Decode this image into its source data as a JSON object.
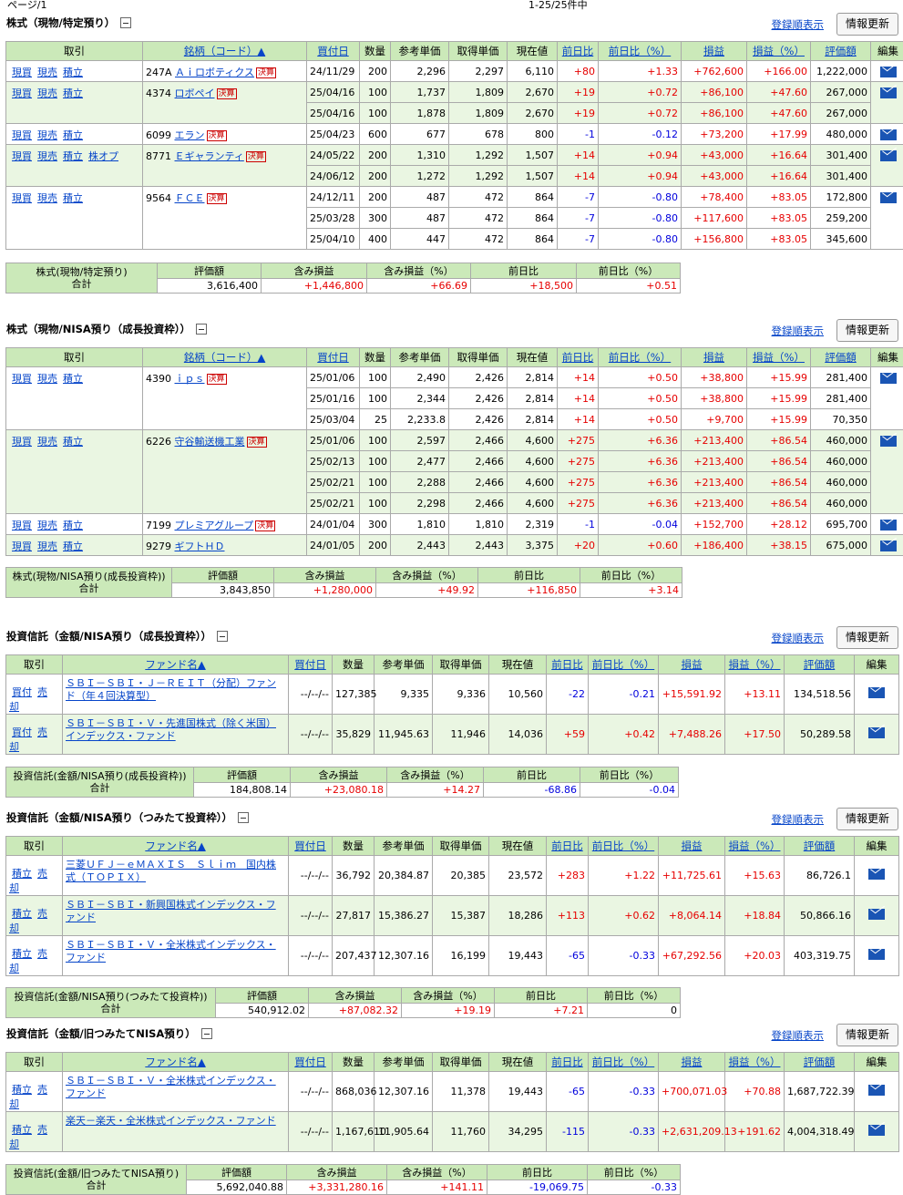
{
  "header": {
    "page": "ページ/1",
    "range": "1-25/25件中"
  },
  "common": {
    "link": "登録順表示",
    "button": "情報更新"
  },
  "sections": [
    {
      "title": "株式（現物/特定預り）",
      "type": "stock",
      "cols": [
        "取引",
        "銘柄（コード）▲",
        "買付日",
        "数量",
        "参考単価",
        "取得単価",
        "現在値",
        "前日比",
        "前日比（%）",
        "損益",
        "損益（%）",
        "評価額",
        "編集"
      ],
      "colLinks": [
        false,
        true,
        true,
        false,
        false,
        false,
        false,
        true,
        true,
        true,
        true,
        true,
        false
      ],
      "groups": [
        {
          "actions": [
            "現買",
            "現売",
            "積立"
          ],
          "code": "247A",
          "name": "Ａｉロボティクス",
          "kessan": "決算",
          "rows": [
            [
              "24/11/29",
              "200",
              "2,296",
              "2,297",
              "6,110",
              "+80",
              "+1.33",
              "+762,600",
              "+166.00",
              "1,222,000"
            ]
          ]
        },
        {
          "actions": [
            "現買",
            "現売",
            "積立"
          ],
          "code": "4374",
          "name": "ロボペイ",
          "kessan": "決算",
          "rows": [
            [
              "25/04/16",
              "100",
              "1,737",
              "1,809",
              "2,670",
              "+19",
              "+0.72",
              "+86,100",
              "+47.60",
              "267,000"
            ],
            [
              "25/04/16",
              "100",
              "1,878",
              "1,809",
              "2,670",
              "+19",
              "+0.72",
              "+86,100",
              "+47.60",
              "267,000"
            ]
          ]
        },
        {
          "actions": [
            "現買",
            "現売",
            "積立"
          ],
          "code": "6099",
          "name": "エラン",
          "kessan": "決算",
          "rows": [
            [
              "25/04/23",
              "600",
              "677",
              "678",
              "800",
              "-1",
              "-0.12",
              "+73,200",
              "+17.99",
              "480,000"
            ]
          ]
        },
        {
          "actions": [
            "現買",
            "現売",
            "積立",
            "株オプ"
          ],
          "code": "8771",
          "name": "Ｅギャランティ",
          "kessan": "決算",
          "rows": [
            [
              "24/05/22",
              "200",
              "1,310",
              "1,292",
              "1,507",
              "+14",
              "+0.94",
              "+43,000",
              "+16.64",
              "301,400"
            ],
            [
              "24/06/12",
              "200",
              "1,272",
              "1,292",
              "1,507",
              "+14",
              "+0.94",
              "+43,000",
              "+16.64",
              "301,400"
            ]
          ]
        },
        {
          "actions": [
            "現買",
            "現売",
            "積立"
          ],
          "code": "9564",
          "name": "ＦＣＥ",
          "kessan": "決算",
          "rows": [
            [
              "24/12/11",
              "200",
              "487",
              "472",
              "864",
              "-7",
              "-0.80",
              "+78,400",
              "+83.05",
              "172,800"
            ],
            [
              "25/03/28",
              "300",
              "487",
              "472",
              "864",
              "-7",
              "-0.80",
              "+117,600",
              "+83.05",
              "259,200"
            ],
            [
              "25/04/10",
              "400",
              "447",
              "472",
              "864",
              "-7",
              "-0.80",
              "+156,800",
              "+83.05",
              "345,600"
            ]
          ]
        }
      ],
      "summary": {
        "label": "株式(現物/特定預り)\n合計",
        "cols": [
          "評価額",
          "含み損益",
          "含み損益（%）",
          "前日比",
          "前日比（%）"
        ],
        "values": [
          "3,616,400",
          "+1,446,800",
          "+66.69",
          "+18,500",
          "+0.51"
        ]
      }
    },
    {
      "title": "株式（現物/NISA預り（成長投資枠））",
      "type": "stock",
      "cols": [
        "取引",
        "銘柄（コード）▲",
        "買付日",
        "数量",
        "参考単価",
        "取得単価",
        "現在値",
        "前日比",
        "前日比（%）",
        "損益",
        "損益（%）",
        "評価額",
        "編集"
      ],
      "colLinks": [
        false,
        true,
        true,
        false,
        false,
        false,
        false,
        true,
        true,
        true,
        true,
        true,
        false
      ],
      "groups": [
        {
          "actions": [
            "現買",
            "現売",
            "積立"
          ],
          "code": "4390",
          "name": "ｉｐｓ",
          "kessan": "決算",
          "rows": [
            [
              "25/01/06",
              "100",
              "2,490",
              "2,426",
              "2,814",
              "+14",
              "+0.50",
              "+38,800",
              "+15.99",
              "281,400"
            ],
            [
              "25/01/16",
              "100",
              "2,344",
              "2,426",
              "2,814",
              "+14",
              "+0.50",
              "+38,800",
              "+15.99",
              "281,400"
            ],
            [
              "25/03/04",
              "25",
              "2,233.8",
              "2,426",
              "2,814",
              "+14",
              "+0.50",
              "+9,700",
              "+15.99",
              "70,350"
            ]
          ]
        },
        {
          "actions": [
            "現買",
            "現売",
            "積立"
          ],
          "code": "6226",
          "name": "守谷輸送機工業",
          "kessan": "決算",
          "rows": [
            [
              "25/01/06",
              "100",
              "2,597",
              "2,466",
              "4,600",
              "+275",
              "+6.36",
              "+213,400",
              "+86.54",
              "460,000"
            ],
            [
              "25/02/13",
              "100",
              "2,477",
              "2,466",
              "4,600",
              "+275",
              "+6.36",
              "+213,400",
              "+86.54",
              "460,000"
            ],
            [
              "25/02/21",
              "100",
              "2,288",
              "2,466",
              "4,600",
              "+275",
              "+6.36",
              "+213,400",
              "+86.54",
              "460,000"
            ],
            [
              "25/02/21",
              "100",
              "2,298",
              "2,466",
              "4,600",
              "+275",
              "+6.36",
              "+213,400",
              "+86.54",
              "460,000"
            ]
          ]
        },
        {
          "actions": [
            "現買",
            "現売",
            "積立"
          ],
          "code": "7199",
          "name": "プレミアグループ",
          "kessan": "決算",
          "rows": [
            [
              "24/01/04",
              "300",
              "1,810",
              "1,810",
              "2,319",
              "-1",
              "-0.04",
              "+152,700",
              "+28.12",
              "695,700"
            ]
          ]
        },
        {
          "actions": [
            "現買",
            "現売",
            "積立"
          ],
          "code": "9279",
          "name": "ギフトＨＤ",
          "kessan": "",
          "rows": [
            [
              "24/01/05",
              "200",
              "2,443",
              "2,443",
              "3,375",
              "+20",
              "+0.60",
              "+186,400",
              "+38.15",
              "675,000"
            ]
          ]
        }
      ],
      "summary": {
        "label": "株式(現物/NISA預り(成長投資枠))\n合計",
        "cols": [
          "評価額",
          "含み損益",
          "含み損益（%）",
          "前日比",
          "前日比（%）"
        ],
        "values": [
          "3,843,850",
          "+1,280,000",
          "+49.92",
          "+116,850",
          "+3.14"
        ]
      }
    },
    {
      "title": "投資信託（金額/NISA預り（成長投資枠））",
      "type": "fund",
      "cols": [
        "取引",
        "ファンド名▲",
        "買付日",
        "数量",
        "参考単価",
        "取得単価",
        "現在値",
        "前日比",
        "前日比（%）",
        "損益",
        "損益（%）",
        "評価額",
        "編集"
      ],
      "colLinks": [
        false,
        true,
        true,
        false,
        false,
        false,
        false,
        true,
        true,
        true,
        true,
        true,
        false
      ],
      "groups": [
        {
          "actions": [
            "買付",
            "売却"
          ],
          "name": "ＳＢＩ－ＳＢＩ・Ｊ－ＲＥＩＴ（分配）ファンド（年４回決算型）",
          "rows": [
            [
              "--/--/--",
              "127,385",
              "9,335",
              "9,336",
              "10,560",
              "-22",
              "-0.21",
              "+15,591.92",
              "+13.11",
              "134,518.56"
            ]
          ]
        },
        {
          "actions": [
            "買付",
            "売却"
          ],
          "name": "ＳＢＩ－ＳＢＩ・Ｖ・先進国株式（除く米国）インデックス・ファンド",
          "rows": [
            [
              "--/--/--",
              "35,829",
              "11,945.63",
              "11,946",
              "14,036",
              "+59",
              "+0.42",
              "+7,488.26",
              "+17.50",
              "50,289.58"
            ]
          ]
        }
      ],
      "summary": {
        "label": "投資信託(金額/NISA預り(成長投資枠))\n合計",
        "cols": [
          "評価額",
          "含み損益",
          "含み損益（%）",
          "前日比",
          "前日比（%）"
        ],
        "values": [
          "184,808.14",
          "+23,080.18",
          "+14.27",
          "-68.86",
          "-0.04"
        ]
      }
    },
    {
      "title": "投資信託（金額/NISA預り（つみたて投資枠））",
      "type": "fund",
      "cols": [
        "取引",
        "ファンド名▲",
        "買付日",
        "数量",
        "参考単価",
        "取得単価",
        "現在値",
        "前日比",
        "前日比（%）",
        "損益",
        "損益（%）",
        "評価額",
        "編集"
      ],
      "colLinks": [
        false,
        true,
        true,
        false,
        false,
        false,
        false,
        true,
        true,
        true,
        true,
        true,
        false
      ],
      "groups": [
        {
          "actions": [
            "積立",
            "売却"
          ],
          "name": "三菱ＵＦＪ－ｅＭＡＸＩＳ　Ｓｌｉｍ　国内株式（ＴＯＰＩＸ）",
          "rows": [
            [
              "--/--/--",
              "36,792",
              "20,384.87",
              "20,385",
              "23,572",
              "+283",
              "+1.22",
              "+11,725.61",
              "+15.63",
              "86,726.1"
            ]
          ]
        },
        {
          "actions": [
            "積立",
            "売却"
          ],
          "name": "ＳＢＩ－ＳＢＩ・新興国株式インデックス・ファンド",
          "rows": [
            [
              "--/--/--",
              "27,817",
              "15,386.27",
              "15,387",
              "18,286",
              "+113",
              "+0.62",
              "+8,064.14",
              "+18.84",
              "50,866.16"
            ]
          ]
        },
        {
          "actions": [
            "積立",
            "売却"
          ],
          "name": "ＳＢＩ－ＳＢＩ・Ｖ・全米株式インデックス・ファンド",
          "rows": [
            [
              "--/--/--",
              "207,437",
              "12,307.16",
              "16,199",
              "19,443",
              "-65",
              "-0.33",
              "+67,292.56",
              "+20.03",
              "403,319.75"
            ]
          ]
        }
      ],
      "summary": {
        "label": "投資信託(金額/NISA預り(つみたて投資枠))\n合計",
        "cols": [
          "評価額",
          "含み損益",
          "含み損益（%）",
          "前日比",
          "前日比（%）"
        ],
        "values": [
          "540,912.02",
          "+87,082.32",
          "+19.19",
          "+7.21",
          "0"
        ]
      }
    },
    {
      "title": "投資信託（金額/旧つみたてNISA預り）",
      "type": "fund",
      "cols": [
        "取引",
        "ファンド名▲",
        "買付日",
        "数量",
        "参考単価",
        "取得単価",
        "現在値",
        "前日比",
        "前日比（%）",
        "損益",
        "損益（%）",
        "評価額",
        "編集"
      ],
      "colLinks": [
        false,
        true,
        true,
        false,
        false,
        false,
        false,
        true,
        true,
        true,
        true,
        true,
        false
      ],
      "groups": [
        {
          "actions": [
            "積立",
            "売却"
          ],
          "name": "ＳＢＩ－ＳＢＩ・Ｖ・全米株式インデックス・ファンド",
          "rows": [
            [
              "--/--/--",
              "868,036",
              "12,307.16",
              "11,378",
              "19,443",
              "-65",
              "-0.33",
              "+700,071.03",
              "+70.88",
              "1,687,722.39"
            ]
          ]
        },
        {
          "actions": [
            "積立",
            "売却"
          ],
          "name": "楽天－楽天・全米株式インデックス・ファンド",
          "rows": [
            [
              "--/--/--",
              "1,167,610",
              "11,905.64",
              "11,760",
              "34,295",
              "-115",
              "-0.33",
              "+2,631,209.13",
              "+191.62",
              "4,004,318.49"
            ]
          ]
        }
      ],
      "summary": {
        "label": "投資信託(金額/旧つみたてNISA預り)\n合計",
        "cols": [
          "評価額",
          "含み損益",
          "含み損益（%）",
          "前日比",
          "前日比（%）"
        ],
        "values": [
          "5,692,040.88",
          "+3,331,280.16",
          "+141.11",
          "-19,069.75",
          "-0.33"
        ]
      }
    }
  ]
}
